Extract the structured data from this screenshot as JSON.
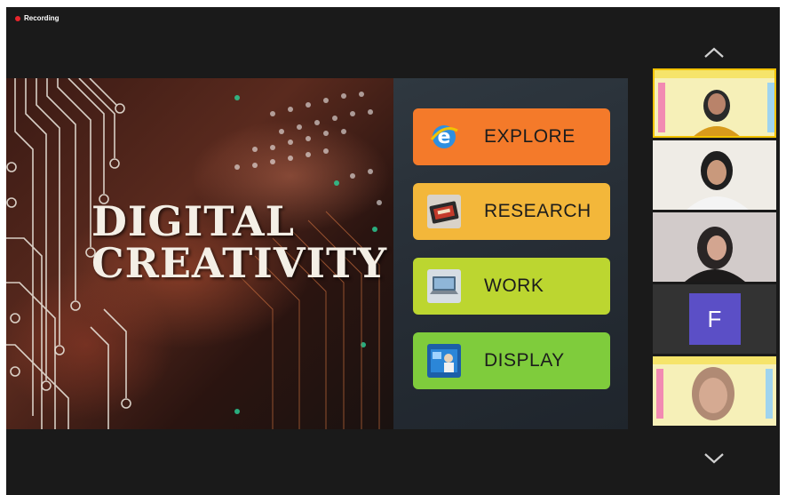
{
  "recording": {
    "label": "Recording"
  },
  "slide": {
    "title_line1": "DIGITAL",
    "title_line2": "CREATIVITY",
    "menu": [
      {
        "label": "EXPLORE",
        "color": "#f47a2a",
        "icon": "browser-e-icon"
      },
      {
        "label": "RESEARCH",
        "color": "#f3b73a",
        "icon": "research-image-icon"
      },
      {
        "label": "WORK",
        "color": "#bcd630",
        "icon": "laptop-image-icon"
      },
      {
        "label": "DISPLAY",
        "color": "#7fcc3c",
        "icon": "display-image-icon"
      }
    ]
  },
  "participants": [
    {
      "type": "video",
      "active": true,
      "name": "participant-1"
    },
    {
      "type": "video",
      "active": false,
      "name": "participant-2"
    },
    {
      "type": "video",
      "active": false,
      "name": "participant-3"
    },
    {
      "type": "initial",
      "active": false,
      "initial": "F"
    },
    {
      "type": "video",
      "active": false,
      "name": "participant-5"
    }
  ],
  "colors": {
    "accent_active": "#f2c200",
    "recording": "#e8262c",
    "avatar": "#5b4fc6"
  }
}
